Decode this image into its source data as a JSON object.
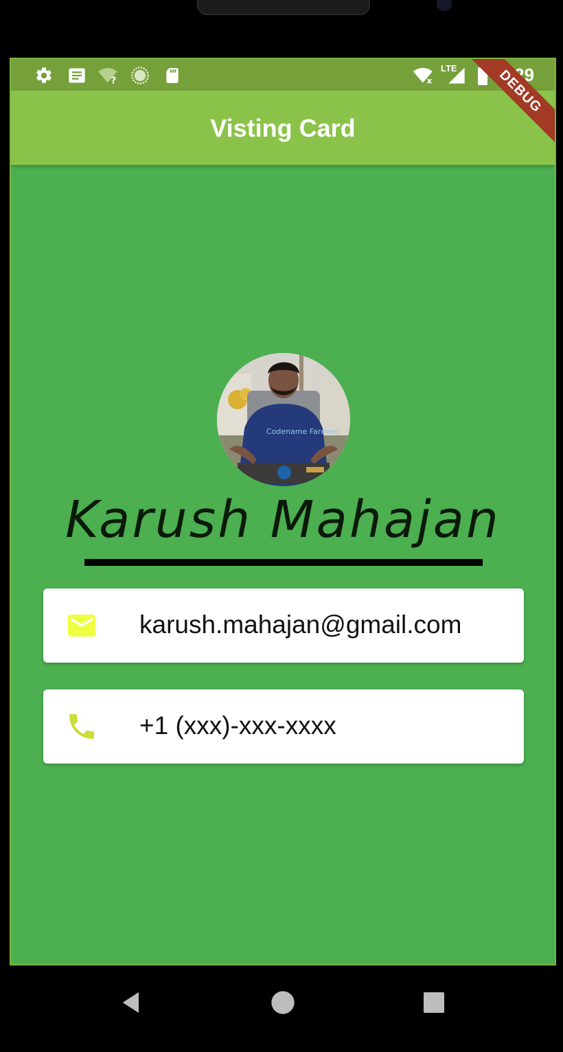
{
  "status_bar": {
    "time": "9:29",
    "network_label": "LTE",
    "icons": [
      "gear-icon",
      "notification-icon",
      "wifi-question-icon",
      "circle-loading-icon",
      "sd-card-icon",
      "wifi-icon",
      "signal-icon",
      "battery-icon"
    ]
  },
  "debug_banner": "DEBUG",
  "app_bar": {
    "title": "Visting Card"
  },
  "profile": {
    "name": "Karush Mahajan",
    "shirt_text": "Codename Farewell"
  },
  "contacts": [
    {
      "icon": "email-icon",
      "value": "karush.mahajan@gmail.com"
    },
    {
      "icon": "phone-icon",
      "value": "+1 (xxx)-xxx-xxxx"
    }
  ],
  "colors": {
    "background": "#4caf50",
    "app_bar": "#8bc34a",
    "status_bar": "#76a03a",
    "icon_accent": "#cddc39",
    "card": "#ffffff"
  }
}
